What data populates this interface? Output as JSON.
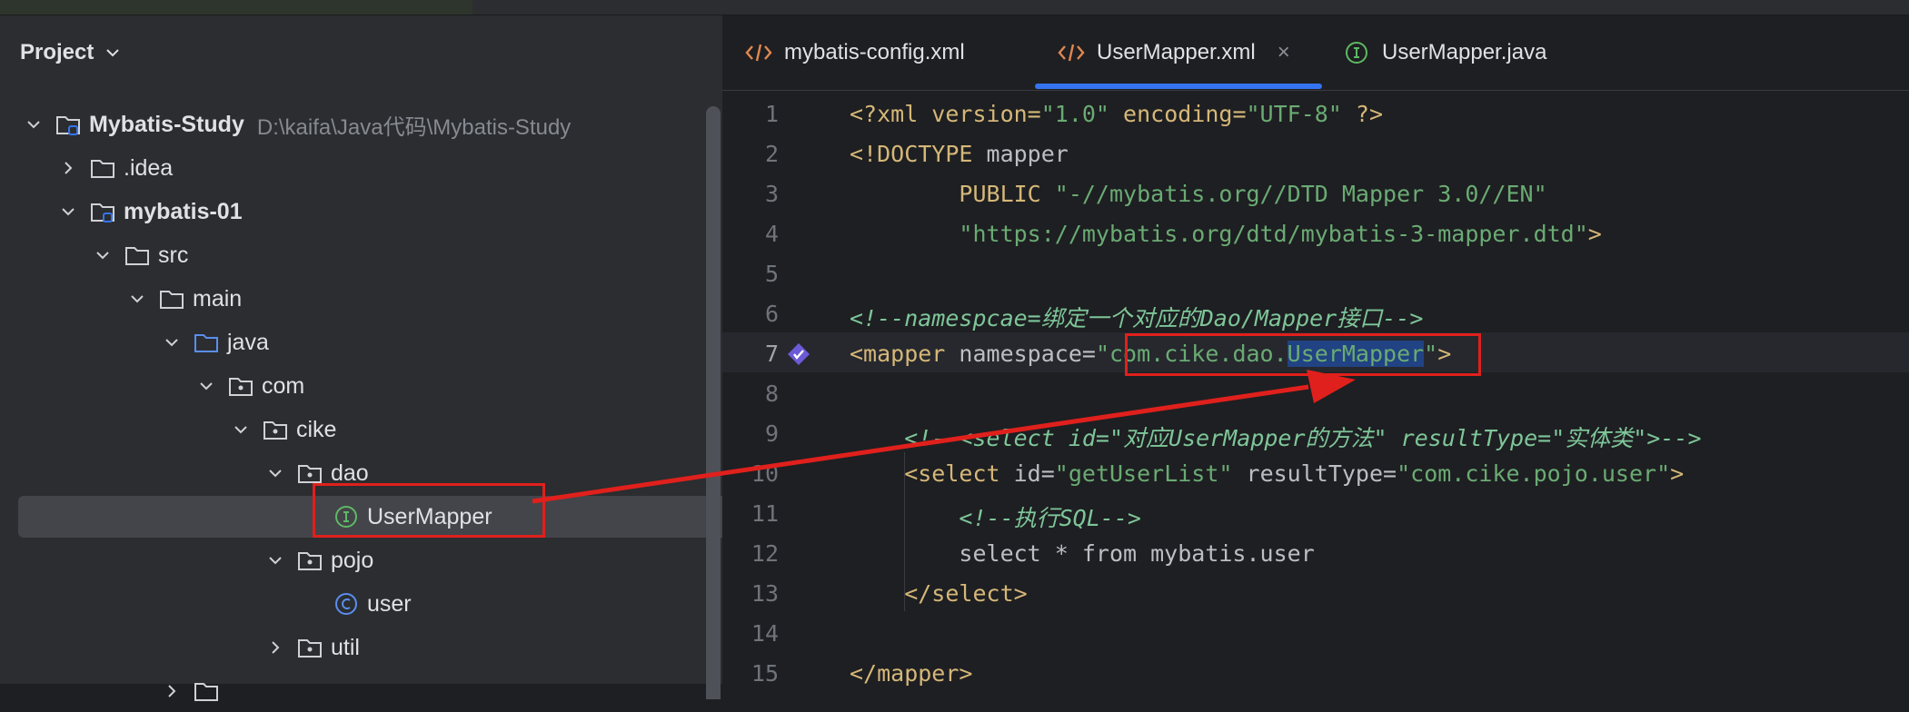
{
  "project_panel": {
    "title": "Project",
    "tree": [
      {
        "label": "Mybatis-Study",
        "path": "D:\\kaifa\\Java代码\\Mybatis-Study",
        "bold": true
      },
      {
        "label": ".idea"
      },
      {
        "label": "mybatis-01",
        "bold": true
      },
      {
        "label": "src"
      },
      {
        "label": "main"
      },
      {
        "label": "java"
      },
      {
        "label": "com"
      },
      {
        "label": "cike"
      },
      {
        "label": "dao"
      },
      {
        "label": "UserMapper",
        "selected": true
      },
      {
        "label": "pojo"
      },
      {
        "label": "user"
      },
      {
        "label": "util"
      }
    ]
  },
  "editor": {
    "tabs": [
      {
        "label": "mybatis-config.xml",
        "icon": "xml-file-icon"
      },
      {
        "label": "UserMapper.xml",
        "icon": "xml-file-icon",
        "active": true
      },
      {
        "label": "UserMapper.java",
        "icon": "interface-icon"
      }
    ],
    "close_glyph": "×",
    "line_numbers": [
      "1",
      "2",
      "3",
      "4",
      "5",
      "6",
      "7",
      "8",
      "9",
      "10",
      "11",
      "12",
      "13",
      "14",
      "15"
    ],
    "lines": {
      "l1_a": "<?xml version=",
      "l1_b": "\"1.0\"",
      "l1_c": " encoding=",
      "l1_d": "\"UTF-8\"",
      "l1_e": " ?>",
      "l2_a": "<!DOCTYPE",
      "l2_b": " mapper",
      "l3_a": "        PUBLIC ",
      "l3_b": "\"-//mybatis.org//DTD Mapper 3.0//EN\"",
      "l4_a": "        ",
      "l4_b": "\"https://mybatis.org/dtd/mybatis-3-mapper.dtd\"",
      "l4_c": ">",
      "l6": "<!--namespcae=绑定一个对应的Dao/Mapper接口-->",
      "l7_a": "<mapper",
      "l7_b": " namespace=",
      "l7_c": "\"com.cike.dao.",
      "l7_d": "UserMapper",
      "l7_e": "\"",
      "l7_f": ">",
      "l9": "    <!--<select id=\"对应UserMapper的方法\" resultType=\"实体类\">-->",
      "l10_a": "    <select",
      "l10_b": " id=",
      "l10_c": "\"getUserList\"",
      "l10_d": " resultType=",
      "l10_e": "\"com.cike.pojo.user\"",
      "l10_f": ">",
      "l11": "        <!--执行SQL-->",
      "l12": "        select * from mybatis.user",
      "l13": "    </select>",
      "l15": "</mapper>"
    }
  },
  "colors": {
    "accent": "#3574f0",
    "annotation": "#e0201c",
    "selection": "#214283"
  }
}
